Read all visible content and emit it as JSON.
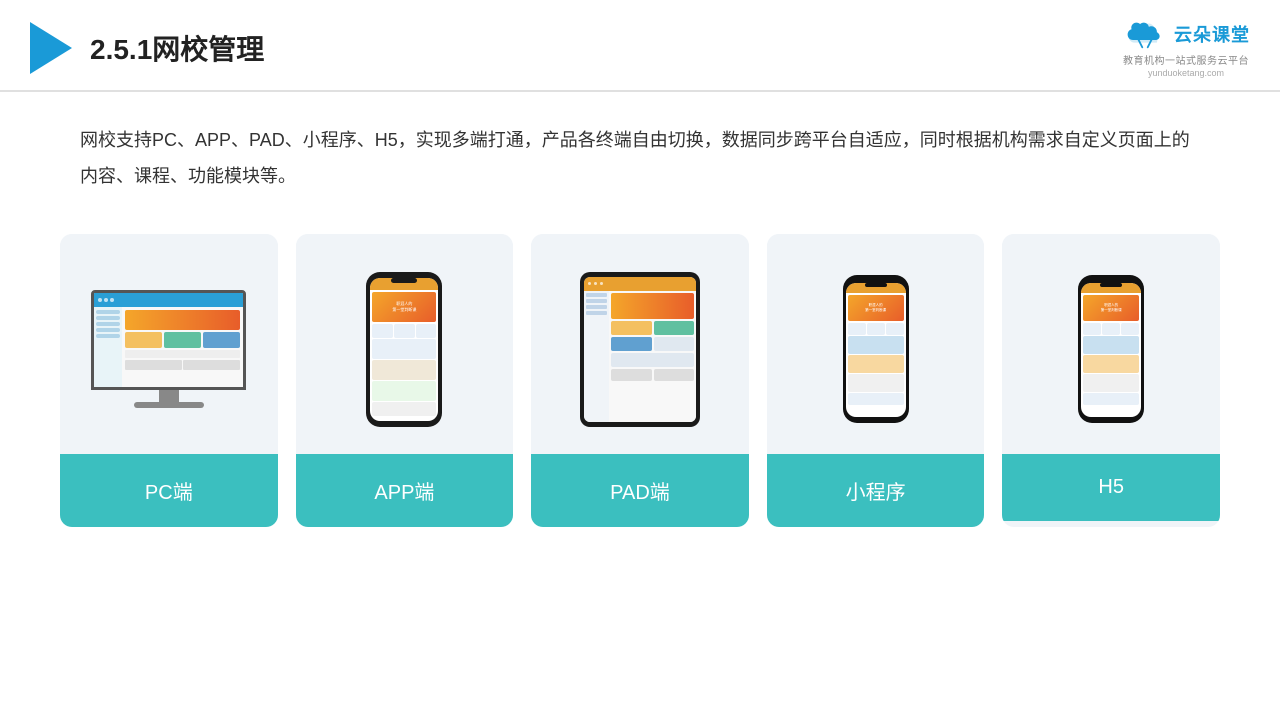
{
  "header": {
    "title": "2.5.1网校管理",
    "logo_main": "云朵课堂",
    "logo_sub": "教育机构一站\n式服务云平台",
    "logo_url": "yunduoketang.com"
  },
  "description": {
    "text": "网校支持PC、APP、PAD、小程序、H5，实现多端打通，产品各终端自由切换，数据同步跨平台自适应，同时根据机构需求自定义页面上的内容、课程、功能模块等。"
  },
  "cards": [
    {
      "id": "pc",
      "label": "PC端"
    },
    {
      "id": "app",
      "label": "APP端"
    },
    {
      "id": "pad",
      "label": "PAD端"
    },
    {
      "id": "miniprogram",
      "label": "小程序"
    },
    {
      "id": "h5",
      "label": "H5"
    }
  ],
  "colors": {
    "accent": "#3bbfbf",
    "header_line": "#e0e0e0",
    "play_icon": "#1a9ad7",
    "logo_color": "#1a9ad7"
  }
}
